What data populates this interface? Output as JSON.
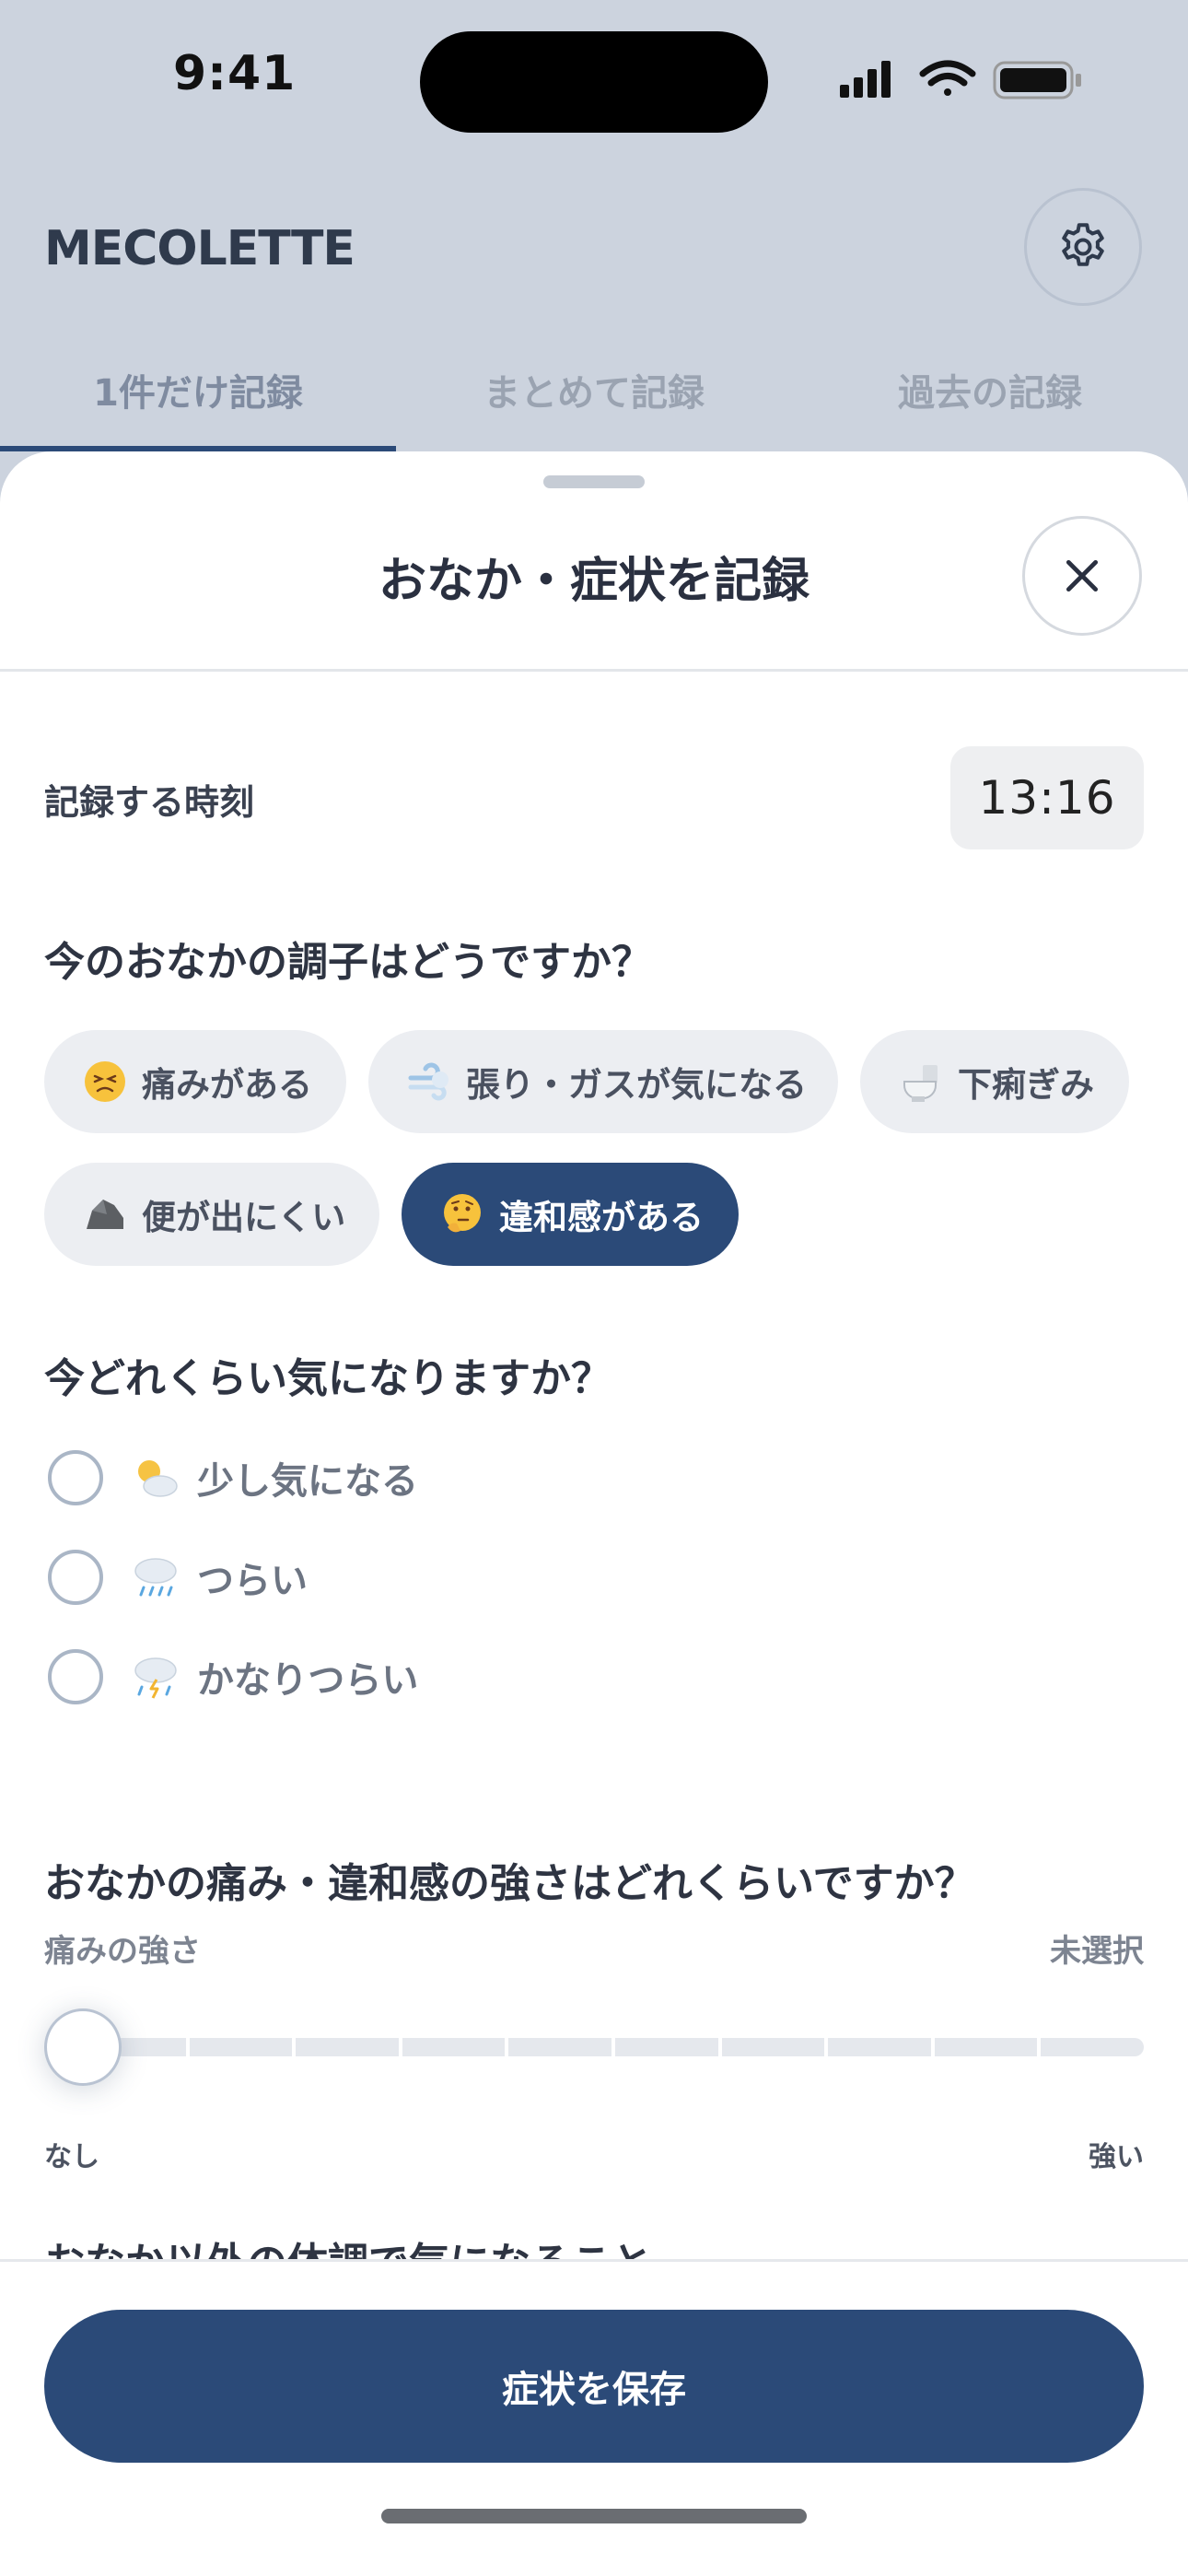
{
  "status": {
    "time": "9:41"
  },
  "app": {
    "logo": "MECOLETTE"
  },
  "tabs": [
    {
      "label": "1件だけ記録",
      "active": true
    },
    {
      "label": "まとめて記録",
      "active": false
    },
    {
      "label": "過去の記録",
      "active": false
    }
  ],
  "sheet": {
    "title": "おなか・症状を記録",
    "time_label": "記録する時刻",
    "time_value": "13:16"
  },
  "condition": {
    "question": "今のおなかの調子はどうですか？",
    "options": [
      {
        "label": "痛みがある",
        "icon": "persevering-face-emoji",
        "selected": false
      },
      {
        "label": "張り・ガスが気になる",
        "icon": "dash-emoji",
        "selected": false
      },
      {
        "label": "下痢ぎみ",
        "icon": "toilet-emoji",
        "selected": false
      },
      {
        "label": "便が出にくい",
        "icon": "rock-emoji",
        "selected": false
      },
      {
        "label": "違和感がある",
        "icon": "thinking-face-emoji",
        "selected": true
      }
    ]
  },
  "severity": {
    "question": "今どれくらい気になりますか？",
    "options": [
      {
        "label": "少し気になる",
        "icon": "sun-behind-cloud-emoji"
      },
      {
        "label": "つらい",
        "icon": "rain-cloud-emoji"
      },
      {
        "label": "かなりつらい",
        "icon": "thunder-rain-cloud-emoji"
      }
    ]
  },
  "intensity": {
    "question": "おなかの痛み・違和感の強さはどれくらいですか？",
    "label": "痛みの強さ",
    "value_text": "未選択",
    "min_label": "なし",
    "max_label": "強い",
    "level": 0
  },
  "next_section": {
    "title": "おなか以外の体調で気になること"
  },
  "footer": {
    "save_label": "症状を保存"
  },
  "colors": {
    "accent": "#2b4a78",
    "backdrop": "#ccd3de"
  }
}
